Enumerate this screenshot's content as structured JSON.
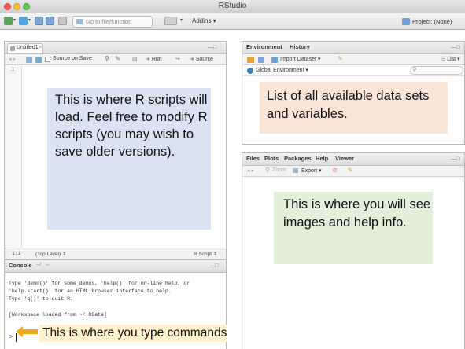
{
  "window": {
    "title": "RStudio"
  },
  "toolbar": {
    "goto_placeholder": "Go to file/function",
    "addins_label": "Addins",
    "project_label": "Project: (None)"
  },
  "source_pane": {
    "tab_label": "Untitled1",
    "source_on_save_label": "Source on Save",
    "run_label": "Run",
    "source_label": "Source",
    "line_number": "1",
    "status_position": "1:1",
    "status_scope": "(Top Level)",
    "status_type": "R Script",
    "note": "This is where R scripts will load. Feel free to modify R scripts (you may wish to save older versions)."
  },
  "env_pane": {
    "tabs": [
      "Environment",
      "History"
    ],
    "import_label": "Import Dataset",
    "list_label": "List",
    "global_env_label": "Global Environment",
    "note": "List of all available data sets and variables."
  },
  "files_pane": {
    "tabs": [
      "Files",
      "Plots",
      "Packages",
      "Help",
      "Viewer"
    ],
    "zoom_label": "Zoom",
    "export_label": "Export",
    "note": "This is where you will see images and help info."
  },
  "console_pane": {
    "tab_label": "Console",
    "path": "~/",
    "lines": [
      "Type 'demo()' for some demos, 'help()' for on-line help, or",
      "'help.start()' for an HTML browser interface to help.",
      "Type 'q()' to quit R.",
      "",
      "[Workspace loaded from ~/.RData]"
    ],
    "prompt": ">",
    "note": "This is where you type commands"
  },
  "colors": {
    "note_blue": "#dae3f3",
    "note_orange": "#fbe5d6",
    "note_green": "#e2f0d9",
    "arrow": "#f0a81e"
  }
}
